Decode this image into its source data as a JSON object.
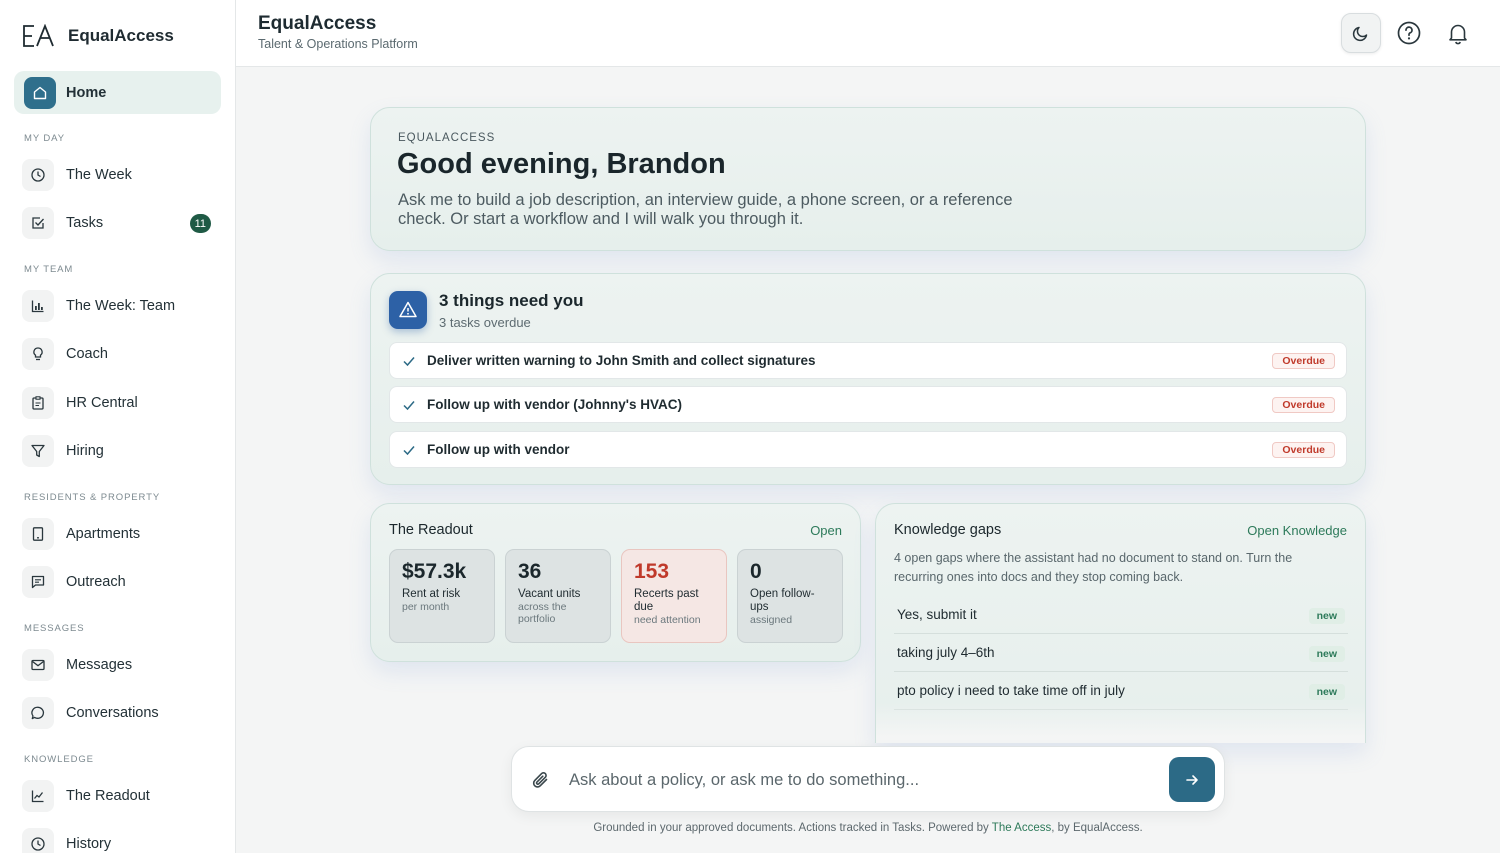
{
  "brand": {
    "logo_text": "EA",
    "name": "EqualAccess"
  },
  "sidebar": {
    "home": {
      "label": "Home"
    },
    "sections": [
      {
        "heading": "My Day",
        "items": [
          {
            "label": "The Week",
            "icon": "clock-icon"
          },
          {
            "label": "Tasks",
            "icon": "checkbox-icon",
            "badge": "11"
          }
        ]
      },
      {
        "heading": "My Team",
        "items": [
          {
            "label": "The Week: Team",
            "icon": "bar-chart-icon"
          },
          {
            "label": "Coach",
            "icon": "lightbulb-icon"
          },
          {
            "label": "HR Central",
            "icon": "clipboard-icon"
          },
          {
            "label": "Hiring",
            "icon": "filter-icon"
          }
        ]
      },
      {
        "heading": "Residents & Property",
        "items": [
          {
            "label": "Apartments",
            "icon": "tablet-icon"
          },
          {
            "label": "Outreach",
            "icon": "message-square-icon"
          }
        ]
      },
      {
        "heading": "Messages",
        "items": [
          {
            "label": "Messages",
            "icon": "mail-icon"
          },
          {
            "label": "Conversations",
            "icon": "chat-bubble-icon"
          }
        ]
      },
      {
        "heading": "Knowledge",
        "items": [
          {
            "label": "The Readout",
            "icon": "line-chart-icon"
          },
          {
            "label": "History",
            "icon": "clock-icon"
          }
        ]
      }
    ]
  },
  "topbar": {
    "title": "EqualAccess",
    "subtitle": "Talent & Operations Platform",
    "icons": [
      "moon-icon",
      "help-icon",
      "bell-icon"
    ]
  },
  "hero": {
    "eyebrow": "EQUALACCESS",
    "greeting": "Good evening, Brandon",
    "description": "Ask me to build a job description, an interview guide, a phone screen, or a reference check. Or start a workflow and I will walk you through it."
  },
  "needs": {
    "title": "3 things need you",
    "subtitle": "3 tasks overdue",
    "tasks": [
      {
        "label": "Deliver written warning to John Smith and collect signatures",
        "status": "Overdue"
      },
      {
        "label": "Follow up with vendor (Johnny's HVAC)",
        "status": "Overdue"
      },
      {
        "label": "Follow up with vendor",
        "status": "Overdue"
      }
    ]
  },
  "readout": {
    "title": "The Readout",
    "link": "Open",
    "stats": [
      {
        "value": "$57.3k",
        "label": "Rent at risk",
        "sub": "per month",
        "alert": false
      },
      {
        "value": "36",
        "label": "Vacant units",
        "sub": "across the portfolio",
        "alert": false
      },
      {
        "value": "153",
        "label": "Recerts past due",
        "sub": "need attention",
        "alert": true
      },
      {
        "value": "0",
        "label": "Open follow-ups",
        "sub": "assigned",
        "alert": false
      }
    ]
  },
  "knowledge": {
    "title": "Knowledge gaps",
    "link": "Open Knowledge",
    "description": "4 open gaps where the assistant had no document to stand on. Turn the recurring ones into docs and they stop coming back.",
    "items": [
      {
        "label": "Yes, submit it",
        "tag": "new"
      },
      {
        "label": "taking july 4–6th",
        "tag": "new"
      },
      {
        "label": "pto policy i need to take time off in july",
        "tag": "new"
      }
    ]
  },
  "chat": {
    "placeholder": "Ask about a policy, or ask me to do something...",
    "value": ""
  },
  "footer": {
    "text_before": "Grounded in your approved documents. Actions tracked in Tasks. Powered by ",
    "brand_link": "The Access",
    "text_after": ", by EqualAccess."
  },
  "colors": {
    "accent": "#2c6a86",
    "accent_green": "#2d7a5a",
    "alert_red": "#c03a2b",
    "badge_green": "#1f5a45"
  }
}
